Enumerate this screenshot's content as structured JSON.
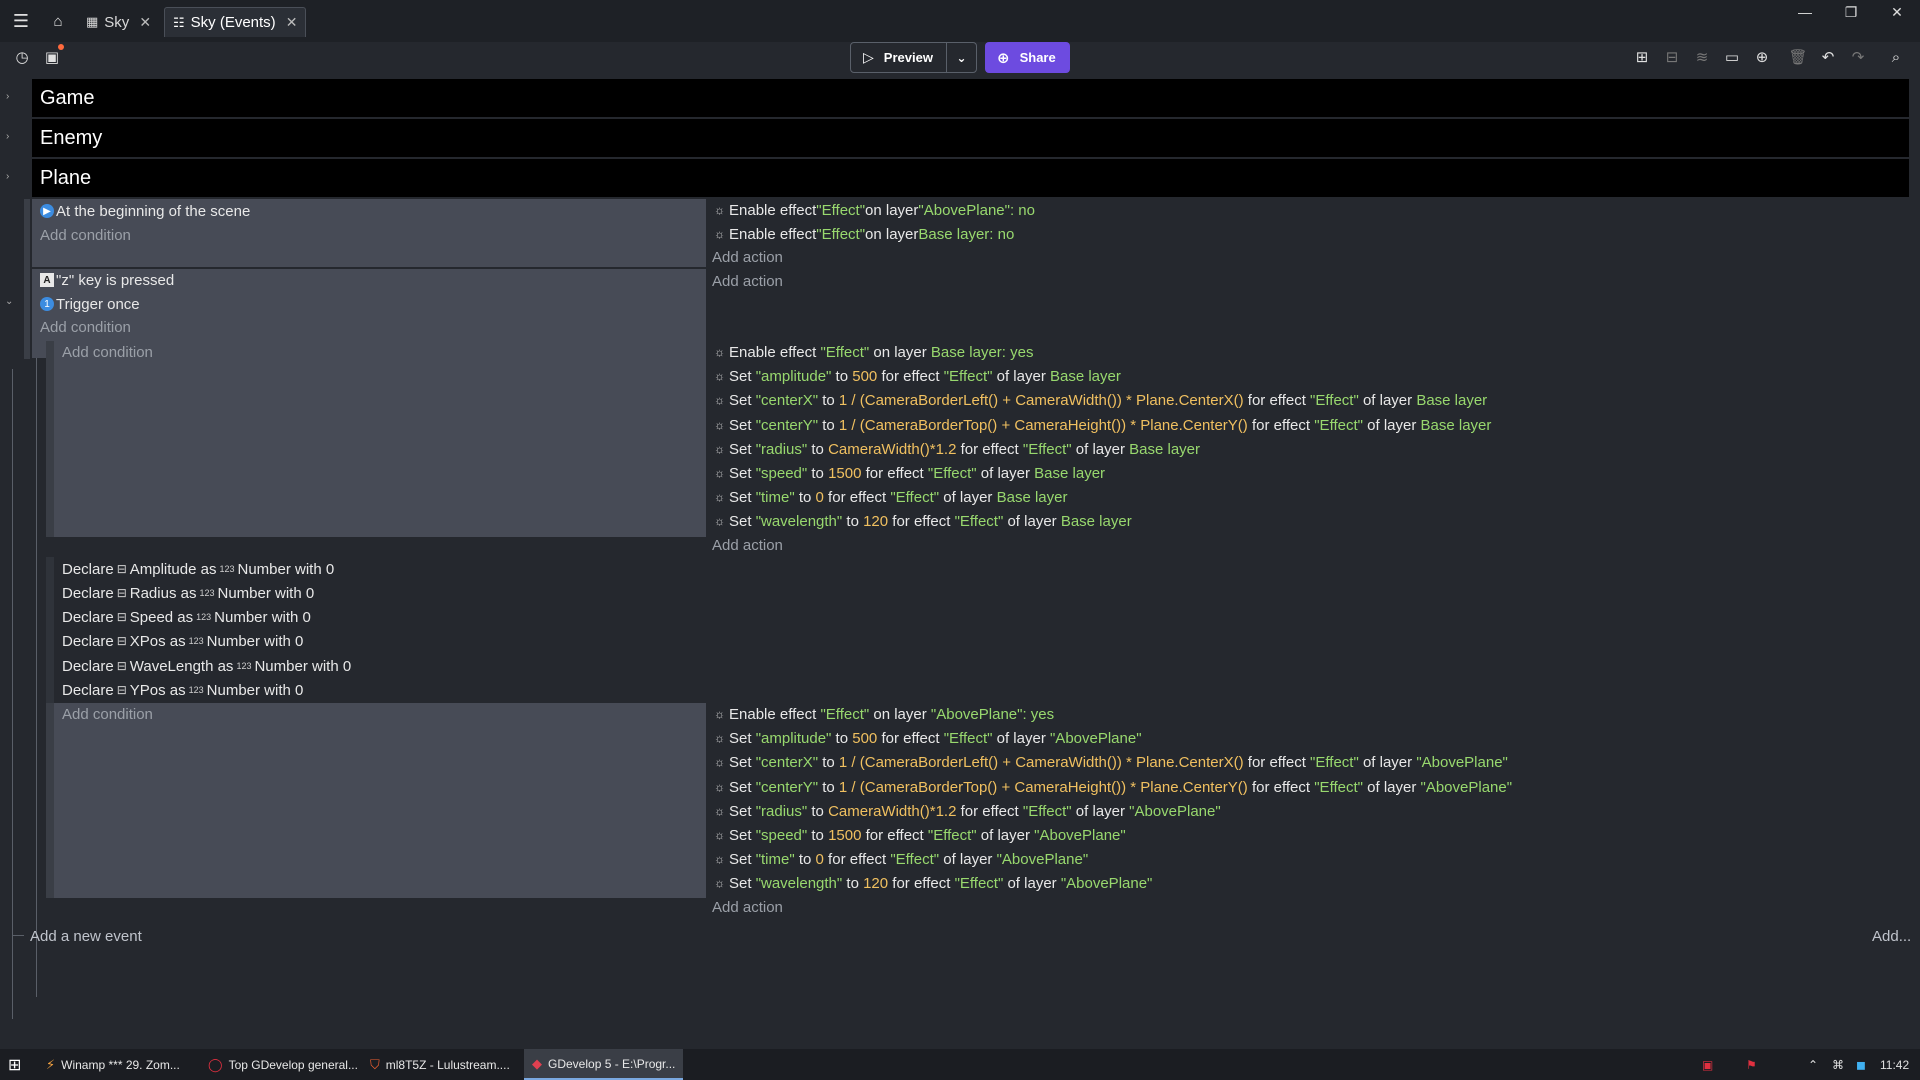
{
  "tabs": [
    {
      "label": "Sky",
      "icon": "scene-icon"
    },
    {
      "label": "Sky (Events)",
      "icon": "events-icon"
    }
  ],
  "toolbar": {
    "preview_label": "Preview",
    "share_label": "Share",
    "share_color": "#6d4be0"
  },
  "groups": [
    {
      "name": "Game"
    },
    {
      "name": "Enemy"
    },
    {
      "name": "Plane"
    }
  ],
  "event1": {
    "conditions": [
      "At the beginning of the scene"
    ],
    "add_condition": "Add condition",
    "actions": [
      {
        "pre": "Enable effect ",
        "effect": "\"Effect\"",
        "mid": " on layer ",
        "layer": "\"AbovePlane\"",
        "val": ": no"
      },
      {
        "pre": "Enable effect ",
        "effect": "\"Effect\"",
        "mid": " on layer ",
        "layer": "Base layer",
        "val": ": no"
      }
    ],
    "add_action": "Add action"
  },
  "event2": {
    "conditions": [
      "\"z\" key is pressed",
      "Trigger once"
    ],
    "add_condition": "Add condition",
    "add_action": "Add action"
  },
  "sub1": {
    "add_condition": "Add condition",
    "add_action": "Add action"
  },
  "declares": [
    {
      "d": "Declare",
      "name": "Amplitude",
      "as": "as",
      "type": "Number with 0"
    },
    {
      "d": "Declare",
      "name": "Radius",
      "as": "as",
      "type": "Number with 0"
    },
    {
      "d": "Declare",
      "name": "Speed",
      "as": "as",
      "type": "Number with 0"
    },
    {
      "d": "Declare",
      "name": "XPos",
      "as": "as",
      "type": "Number with 0"
    },
    {
      "d": "Declare",
      "name": "WaveLength",
      "as": "as",
      "type": "Number with 0"
    },
    {
      "d": "Declare",
      "name": "YPos",
      "as": "as",
      "type": "Number with 0"
    }
  ],
  "sub2": {
    "add_condition": "Add condition",
    "add_action": "Add action"
  },
  "footer": {
    "add_event": "Add a new event",
    "add_more": "Add..."
  },
  "taskbar": [
    {
      "label": "Winamp *** 29. Zom..."
    },
    {
      "label": "Top GDevelop general..."
    },
    {
      "label": "ml8T5Z - Lulustream...."
    },
    {
      "label": "GDevelop 5 - E:\\Progr..."
    }
  ],
  "clock": "11:42"
}
